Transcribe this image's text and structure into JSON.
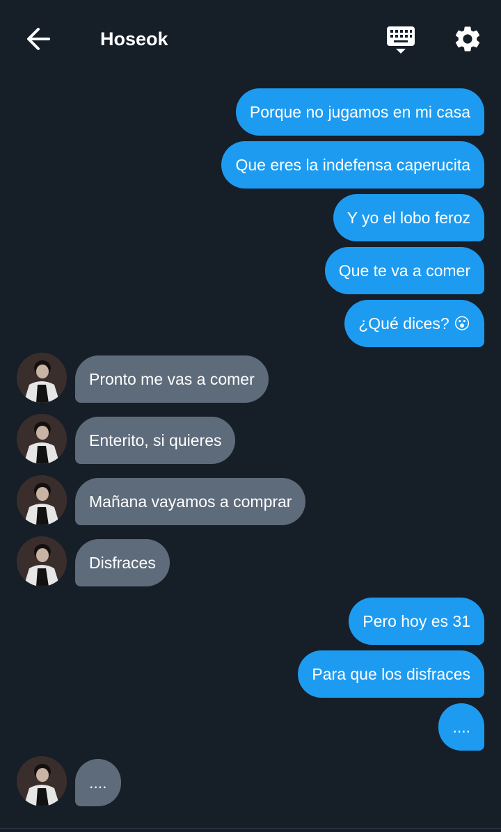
{
  "header": {
    "title": "Hoseok",
    "icons": {
      "back": "arrow-left-icon",
      "keyboard": "keyboard-icon",
      "settings": "gear-icon"
    }
  },
  "colors": {
    "background": "#161e28",
    "outgoing": "#1d9bf0",
    "incoming": "#5e6b7b"
  },
  "messages": [
    {
      "from": "me",
      "text": "Porque no jugamos en mi casa"
    },
    {
      "from": "me",
      "text": "Que eres la indefensa caperucita"
    },
    {
      "from": "me",
      "text": "Y yo el lobo feroz"
    },
    {
      "from": "me",
      "text": "Que te va a comer"
    },
    {
      "from": "me",
      "text": "¿Qué dices? 😮"
    },
    {
      "from": "them",
      "text": "Pronto me vas a comer"
    },
    {
      "from": "them",
      "text": "Enterito, si quieres"
    },
    {
      "from": "them",
      "text": "Mañana vayamos a comprar"
    },
    {
      "from": "them",
      "text": "Disfraces"
    },
    {
      "from": "me",
      "text": "Pero hoy es 31"
    },
    {
      "from": "me",
      "text": "Para que los disfraces"
    },
    {
      "from": "me",
      "text": "...."
    },
    {
      "from": "them",
      "text": "...."
    }
  ]
}
